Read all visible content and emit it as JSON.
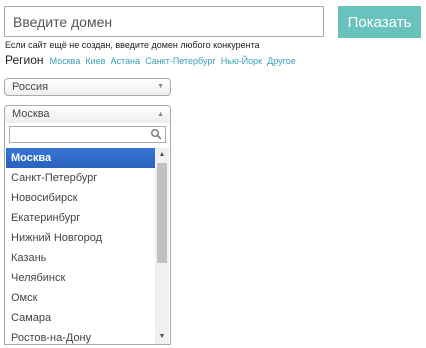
{
  "domain_form": {
    "input_placeholder": "Введите домен",
    "submit_label": "Показать",
    "hint": "Если сайт ещё не создан, введите домен любого конкурента"
  },
  "region": {
    "label": "Регион",
    "quick_links": [
      "Москва",
      "Киев",
      "Астана",
      "Санкт-Петербург",
      "Нью-Йорк",
      "Другое"
    ]
  },
  "country_select": {
    "selected": "Россия",
    "arrow_icon": "chevron-down-icon"
  },
  "city_select": {
    "selected": "Москва",
    "arrow_icon": "chevron-up-icon",
    "search_value": "",
    "search_icon": "search-icon",
    "options": [
      "Москва",
      "Санкт-Петербург",
      "Новосибирск",
      "Екатеринбург",
      "Нижний Новгород",
      "Казань",
      "Челябинск",
      "Омск",
      "Самара",
      "Ростов-на-Дону"
    ],
    "highlighted_index": 0
  },
  "colors": {
    "accent": "#69c3bc",
    "link": "#3a9db5",
    "highlight": "#3875d7"
  }
}
